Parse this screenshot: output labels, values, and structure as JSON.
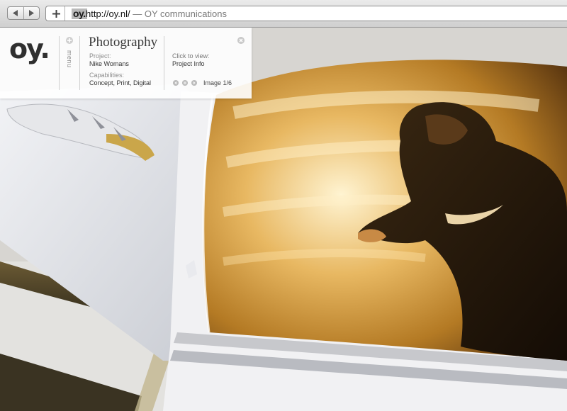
{
  "browser": {
    "favicon_text": "oy.",
    "url": "http://oy.nl/",
    "separator": " — ",
    "page_title": "OY communications"
  },
  "panel": {
    "logo": "oy.",
    "menu_label": "menu",
    "section_title": "Photography",
    "project_label": "Project:",
    "project_value": "Nike Womans",
    "capabilities_label": "Capabilities:",
    "capabilities_value": "Concept, Print, Digital",
    "click_label": "Click to view:",
    "click_link": "Project Info",
    "image_counter": "Image 1/6"
  },
  "colors": {
    "panel_bg": "#ffffff",
    "logo": "#2f2f2f",
    "photo_accent": "#c8902a"
  },
  "icons": [
    "back-arrow-icon",
    "forward-arrow-icon",
    "plus-icon",
    "close-icon"
  ]
}
